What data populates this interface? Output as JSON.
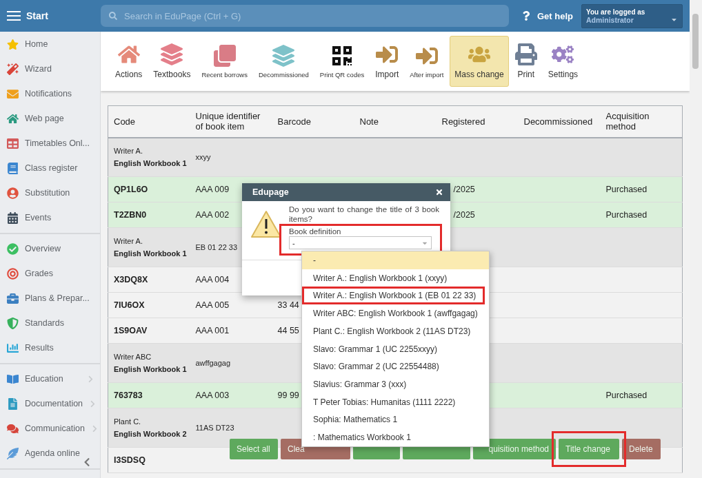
{
  "topbar": {
    "menu_label": "Start",
    "search": {
      "placeholder": "Search in EduPage (Ctrl + G)"
    },
    "help": "Get help",
    "user": {
      "caption": "You are logged as",
      "name": "Administrator"
    }
  },
  "sidebar": {
    "sections": [
      {
        "items": [
          {
            "label": "Home",
            "submenu": false
          },
          {
            "label": "Wizard",
            "submenu": false
          },
          {
            "label": "Notifications",
            "submenu": false
          },
          {
            "label": "Web page",
            "submenu": false
          },
          {
            "label": "Timetables Onl...",
            "submenu": false
          },
          {
            "label": "Class register",
            "submenu": false
          },
          {
            "label": "Substitution",
            "submenu": false
          },
          {
            "label": "Events",
            "submenu": false
          }
        ]
      },
      {
        "items": [
          {
            "label": "Overview",
            "submenu": false
          },
          {
            "label": "Grades",
            "submenu": false
          },
          {
            "label": "Plans & Prepar...",
            "submenu": false
          },
          {
            "label": "Standards",
            "submenu": false
          },
          {
            "label": "Results",
            "submenu": false
          }
        ]
      },
      {
        "items": [
          {
            "label": "Education",
            "submenu": true
          },
          {
            "label": "Documentation",
            "submenu": true
          },
          {
            "label": "Communication",
            "submenu": true
          },
          {
            "label": "Agenda online",
            "submenu": false
          }
        ]
      }
    ]
  },
  "toolbar": [
    {
      "label": "Actions",
      "compact": false,
      "selected": false
    },
    {
      "label": "Textbooks",
      "compact": false,
      "selected": false
    },
    {
      "label": "Recent borrows",
      "compact": true,
      "selected": false
    },
    {
      "label": "Decommissioned",
      "compact": true,
      "selected": false
    },
    {
      "label": "Print QR codes",
      "compact": true,
      "selected": false
    },
    {
      "label": "Import",
      "compact": false,
      "selected": false
    },
    {
      "label": "After import",
      "compact": true,
      "selected": false
    },
    {
      "label": "Mass change",
      "compact": false,
      "selected": true
    },
    {
      "label": "Print",
      "compact": false,
      "selected": false
    },
    {
      "label": "Settings",
      "compact": false,
      "selected": false
    }
  ],
  "table": {
    "columns": [
      "Code",
      "Unique identifier of book item",
      "Barcode",
      "Note",
      "Registered",
      "Decommissioned",
      "Acquisition method"
    ],
    "rows": [
      {
        "kind": "group",
        "author": "Writer A.",
        "title": "English Workbook 1",
        "identifier": "xxyy"
      },
      {
        "kind": "item",
        "selected": true,
        "code": "QP1L6O",
        "identifier": "AAA 009",
        "registered": "/2025",
        "acquisition": "Purchased"
      },
      {
        "kind": "item",
        "selected": true,
        "code": "T2ZBN0",
        "identifier": "AAA 002",
        "registered": "/2025",
        "acquisition": "Purchased"
      },
      {
        "kind": "group",
        "author": "Writer A.",
        "title": "English Workbook 1",
        "identifier": "EB 01 22 33"
      },
      {
        "kind": "item",
        "selected": false,
        "code": "X3DQ8X",
        "identifier": "AAA 004"
      },
      {
        "kind": "item",
        "selected": false,
        "code": "7IU6OX",
        "identifier": "AAA 005",
        "barcode": "33 44"
      },
      {
        "kind": "item",
        "selected": false,
        "code": "1S9OAV",
        "identifier": "AAA 001",
        "barcode": "44 55"
      },
      {
        "kind": "group",
        "author": "Writer ABC",
        "title": "English Workbook 1",
        "identifier": "awffgagag"
      },
      {
        "kind": "item",
        "selected": true,
        "code": "763783",
        "identifier": "AAA 003",
        "barcode": "99 99",
        "acquisition": "Purchased"
      },
      {
        "kind": "group",
        "author": "Plant C.",
        "title": "English Workbook 2",
        "identifier": "11AS DT23"
      },
      {
        "kind": "item",
        "selected": false,
        "code": "I3SDSQ"
      }
    ]
  },
  "actions": [
    {
      "label": "Select all",
      "kind": "primary",
      "highlighted": false
    },
    {
      "label": "Clea",
      "kind": "danger",
      "highlighted": false
    },
    {
      "kind": "primary",
      "highlighted": false
    },
    {
      "kind": "primary",
      "highlighted": false
    },
    {
      "label": "quisition method",
      "kind": "primary",
      "highlighted": false
    },
    {
      "label": "Title change",
      "kind": "primary",
      "highlighted": true
    },
    {
      "label": "Delete",
      "kind": "danger",
      "highlighted": false
    }
  ],
  "dialog": {
    "title": "Edupage",
    "message": "Do you want to change the title of 3 book items?",
    "field": {
      "label": "Book definition",
      "value": "-",
      "highlighted": true
    }
  },
  "dropdown": {
    "options": [
      {
        "label": "-",
        "selected": true,
        "highlighted": false
      },
      {
        "label": "Writer A.: English Workbook 1 (xxyy)",
        "selected": false,
        "highlighted": false
      },
      {
        "label": "Writer A.: English Workbook 1 (EB 01 22 33)",
        "selected": false,
        "highlighted": true
      },
      {
        "label": "Writer ABC: English Workbook 1 (awffgagag)",
        "selected": false,
        "highlighted": false
      },
      {
        "label": "Plant C.: English Workbook 2 (11AS DT23)",
        "selected": false,
        "highlighted": false
      },
      {
        "label": "Slavo: Grammar 1 (UC 2255xxyy)",
        "selected": false,
        "highlighted": false
      },
      {
        "label": "Slavo: Grammar 2 (UC 22554488)",
        "selected": false,
        "highlighted": false
      },
      {
        "label": "Slavius: Grammar 3 (xxx)",
        "selected": false,
        "highlighted": false
      },
      {
        "label": "T Peter Tobias: Humanitas (1111 2222)",
        "selected": false,
        "highlighted": false
      },
      {
        "label": "Sophia: Mathematics 1",
        "selected": false,
        "highlighted": false
      },
      {
        "label": ": Mathematics Workbook 1",
        "selected": false,
        "highlighted": false
      }
    ]
  }
}
